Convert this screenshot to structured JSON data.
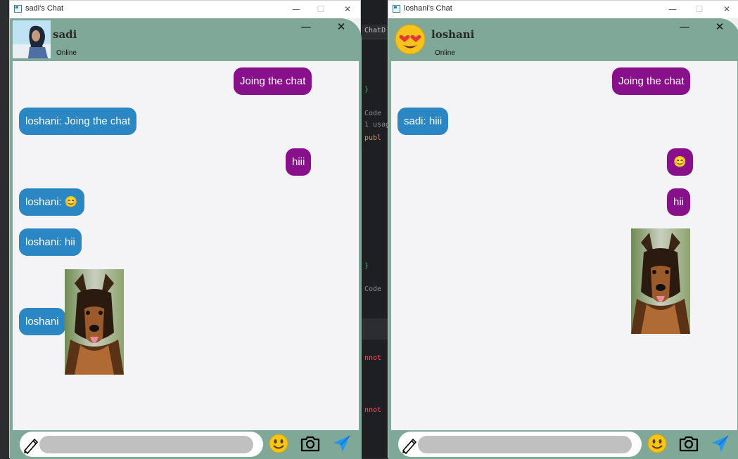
{
  "background_ide": {
    "tab_label": "ChatD",
    "lines": [
      "}",
      "Code",
      "1 usag",
      "publ",
      "}",
      "Code",
      "nnot",
      "nnot"
    ]
  },
  "windows": [
    {
      "os_title": "sadi's Chat",
      "contact_name": "sadi",
      "status": "Online",
      "avatar": "photo-avatar",
      "messages": [
        {
          "dir": "out",
          "text": "Joing the chat"
        },
        {
          "dir": "in",
          "text": "loshani: Joing the chat"
        },
        {
          "dir": "out",
          "text": "hiii"
        },
        {
          "dir": "in",
          "text": "loshani: 😊"
        },
        {
          "dir": "in",
          "text": "loshani: hii"
        },
        {
          "dir": "in",
          "text": "loshani",
          "image": "german-shepherd-photo"
        }
      ]
    },
    {
      "os_title": "loshani's Chat",
      "contact_name": "loshani",
      "status": "Online",
      "avatar": "heart-eyes-emoji",
      "messages": [
        {
          "dir": "out",
          "text": "Joing the chat"
        },
        {
          "dir": "in",
          "text": "sadi: hiii"
        },
        {
          "dir": "out",
          "text": "😊"
        },
        {
          "dir": "out",
          "text": "hii"
        },
        {
          "dir": "out",
          "text": "",
          "image": "german-shepherd-photo"
        }
      ]
    }
  ],
  "window_controls": {
    "minimize": "—",
    "maximize": "☐",
    "close": "✕"
  },
  "chat_controls": {
    "minimize": "—",
    "close": "✕"
  },
  "compose": {
    "icons": [
      "pencil-icon",
      "emoji-icon",
      "camera-icon",
      "send-icon"
    ],
    "input_value": ""
  },
  "colors": {
    "header": "#7fa898",
    "outgoing_bubble": "#88118b",
    "incoming_bubble": "#2b86c4",
    "message_area": "#f4f3f6"
  }
}
